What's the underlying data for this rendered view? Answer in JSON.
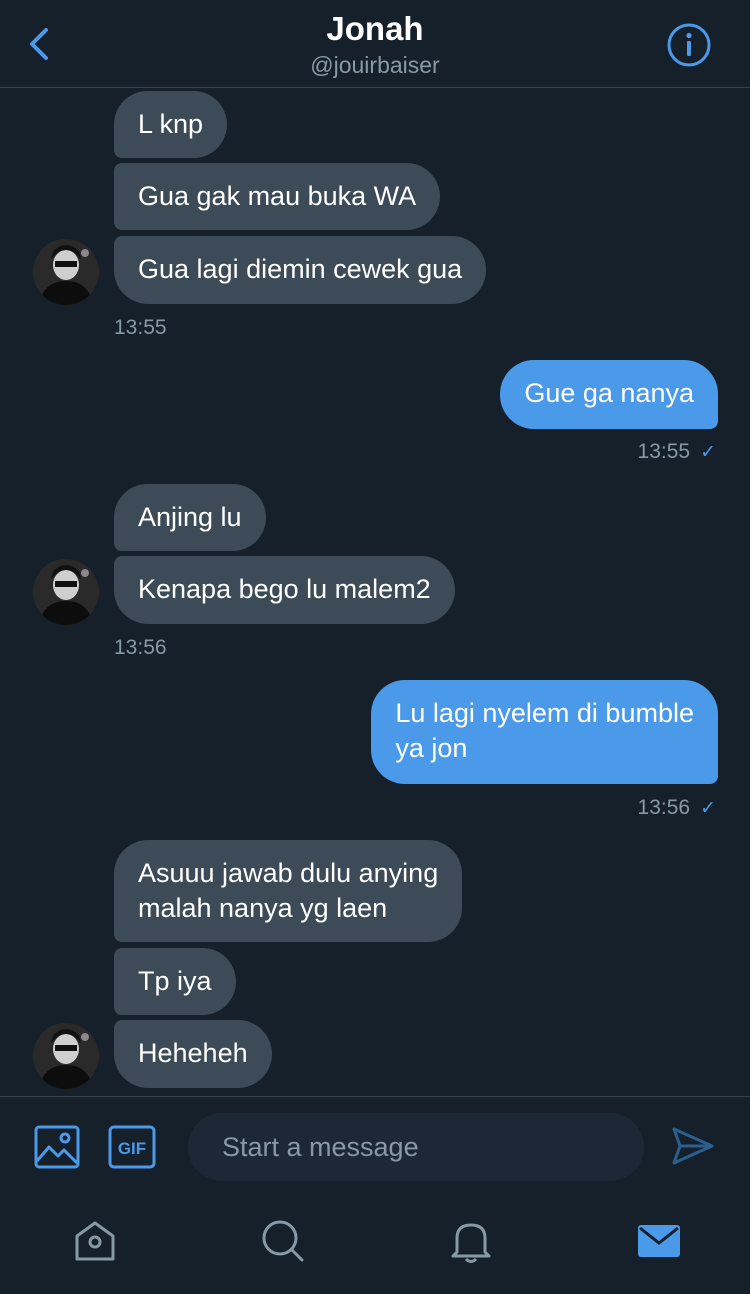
{
  "header": {
    "name": "Jonah",
    "handle": "@jouirbaiser",
    "back_icon": "chevron-left-icon",
    "info_icon": "info-icon",
    "accent": "#4a9ae9"
  },
  "messages": [
    {
      "dir": "in",
      "text": "L knp"
    },
    {
      "dir": "in",
      "text": "Gua gak mau buka WA"
    },
    {
      "dir": "in",
      "text": "Gua lagi diemin cewek gua"
    },
    {
      "dir": "out",
      "text": "Gue ga nanya"
    },
    {
      "dir": "in",
      "text": "Anjing lu"
    },
    {
      "dir": "in",
      "text": "Kenapa bego lu malem2"
    },
    {
      "dir": "out",
      "text": "Lu lagi nyelem di bumble\nya jon"
    },
    {
      "dir": "in",
      "text": "Asuuu jawab dulu anying\nmalah nanya yg laen"
    },
    {
      "dir": "in",
      "text": "Tp iya"
    },
    {
      "dir": "in",
      "text": "Heheheh"
    }
  ],
  "timestamps": [
    "13:55",
    "13:55",
    "13:56",
    "13:56"
  ],
  "read_mark": "✓",
  "composer": {
    "placeholder": "Start a message",
    "gif_label": "GIF",
    "media_icon": "image-icon",
    "send_icon": "send-icon"
  },
  "tabs": [
    {
      "name": "home",
      "icon": "home-icon"
    },
    {
      "name": "search",
      "icon": "search-icon"
    },
    {
      "name": "notifications",
      "icon": "bell-icon"
    },
    {
      "name": "messages",
      "icon": "mail-icon",
      "active": true
    }
  ],
  "colors": {
    "background": "#15202b",
    "incoming_bubble": "#3d4b58",
    "outgoing_bubble": "#4a9ae9",
    "muted_text": "#8899a6"
  }
}
